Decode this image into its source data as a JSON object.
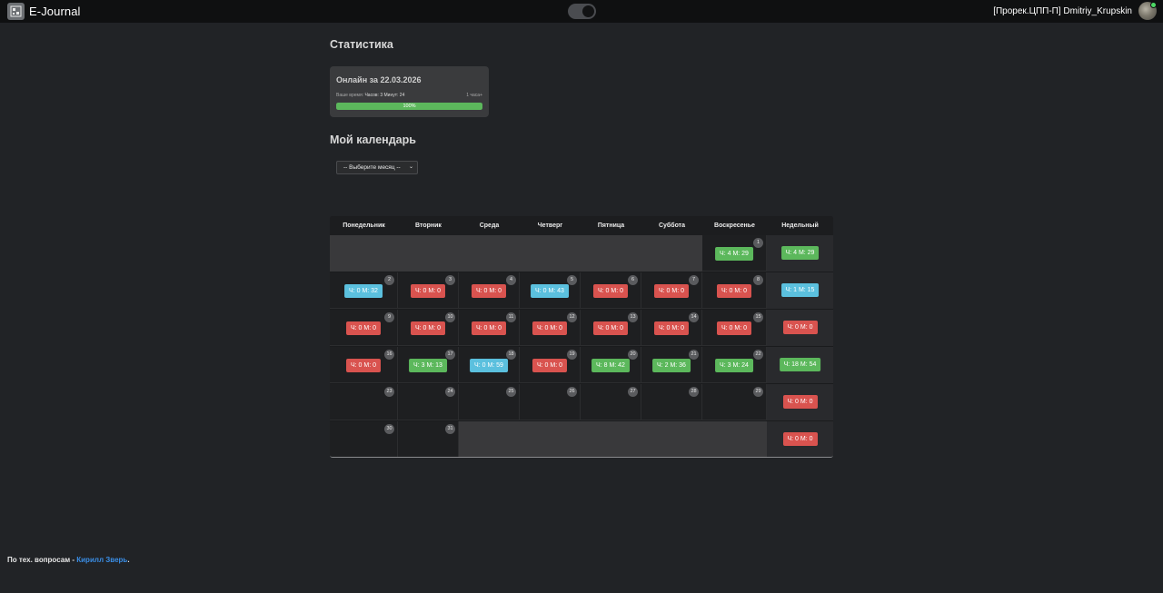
{
  "navbar": {
    "brand": "E-Journal",
    "logo_icon": "journal-logo-icon",
    "user_label": "[Прорек.ЦПП-П] Dmitriy_Krupskin",
    "online_color": "#4cd964"
  },
  "stats": {
    "heading": "Статистика",
    "card_title": "Онлайн за 22.03.2026",
    "time_label": "Ваше время:",
    "time_value": "Часов: 3 Минут: 24",
    "target_label": "1 часа+",
    "progress_percent": 100,
    "progress_text": "100%"
  },
  "calendar": {
    "heading": "Мой календарь",
    "month_select": "-- Выберите месяц --",
    "days": [
      "Понедельник",
      "Вторник",
      "Среда",
      "Четверг",
      "Пятница",
      "Суббота",
      "Воскресенье"
    ],
    "weekly_label": "Недельный",
    "colors": {
      "red": "#d9534f",
      "green": "#5cb85c",
      "blue": "#5bc0de"
    },
    "weeks": [
      {
        "cells": [
          null,
          null,
          null,
          null,
          null,
          null,
          {
            "day": "1",
            "text": "Ч: 4 М: 29",
            "color": "green"
          }
        ],
        "weekly": {
          "text": "Ч: 4 М: 29",
          "color": "green"
        }
      },
      {
        "cells": [
          {
            "day": "2",
            "text": "Ч: 0 М: 32",
            "color": "blue"
          },
          {
            "day": "3",
            "text": "Ч: 0 М: 0",
            "color": "red"
          },
          {
            "day": "4",
            "text": "Ч: 0 М: 0",
            "color": "red"
          },
          {
            "day": "5",
            "text": "Ч: 0 М: 43",
            "color": "blue"
          },
          {
            "day": "6",
            "text": "Ч: 0 М: 0",
            "color": "red"
          },
          {
            "day": "7",
            "text": "Ч: 0 М: 0",
            "color": "red"
          },
          {
            "day": "8",
            "text": "Ч: 0 М: 0",
            "color": "red"
          }
        ],
        "weekly": {
          "text": "Ч: 1 М: 15",
          "color": "blue"
        }
      },
      {
        "cells": [
          {
            "day": "9",
            "text": "Ч: 0 М: 0",
            "color": "red"
          },
          {
            "day": "10",
            "text": "Ч: 0 М: 0",
            "color": "red"
          },
          {
            "day": "11",
            "text": "Ч: 0 М: 0",
            "color": "red"
          },
          {
            "day": "12",
            "text": "Ч: 0 М: 0",
            "color": "red"
          },
          {
            "day": "13",
            "text": "Ч: 0 М: 0",
            "color": "red"
          },
          {
            "day": "14",
            "text": "Ч: 0 М: 0",
            "color": "red"
          },
          {
            "day": "15",
            "text": "Ч: 0 М: 0",
            "color": "red"
          }
        ],
        "weekly": {
          "text": "Ч: 0 М: 0",
          "color": "red"
        }
      },
      {
        "cells": [
          {
            "day": "16",
            "text": "Ч: 0 М: 0",
            "color": "red"
          },
          {
            "day": "17",
            "text": "Ч: 3 М: 13",
            "color": "green"
          },
          {
            "day": "18",
            "text": "Ч: 0 М: 59",
            "color": "blue"
          },
          {
            "day": "19",
            "text": "Ч: 0 М: 0",
            "color": "red"
          },
          {
            "day": "20",
            "text": "Ч: 8 М: 42",
            "color": "green"
          },
          {
            "day": "21",
            "text": "Ч: 2 М: 36",
            "color": "green"
          },
          {
            "day": "22",
            "text": "Ч: 3 М: 24",
            "color": "green"
          }
        ],
        "weekly": {
          "text": "Ч: 18 М: 54",
          "color": "green"
        }
      },
      {
        "cells": [
          {
            "day": "23",
            "text": "",
            "color": ""
          },
          {
            "day": "24",
            "text": "",
            "color": ""
          },
          {
            "day": "25",
            "text": "",
            "color": ""
          },
          {
            "day": "26",
            "text": "",
            "color": ""
          },
          {
            "day": "27",
            "text": "",
            "color": ""
          },
          {
            "day": "28",
            "text": "",
            "color": ""
          },
          {
            "day": "29",
            "text": "",
            "color": ""
          }
        ],
        "weekly": {
          "text": "Ч: 0 М: 0",
          "color": "red"
        }
      },
      {
        "cells": [
          {
            "day": "30",
            "text": "",
            "color": ""
          },
          {
            "day": "31",
            "text": "",
            "color": ""
          },
          null,
          null,
          null,
          null,
          null
        ],
        "weekly": {
          "text": "Ч: 0 М: 0",
          "color": "red"
        }
      }
    ]
  },
  "footer": {
    "prefix": "По тех. вопросам - ",
    "link_text": "Кирилл Зверь",
    "suffix": "."
  }
}
